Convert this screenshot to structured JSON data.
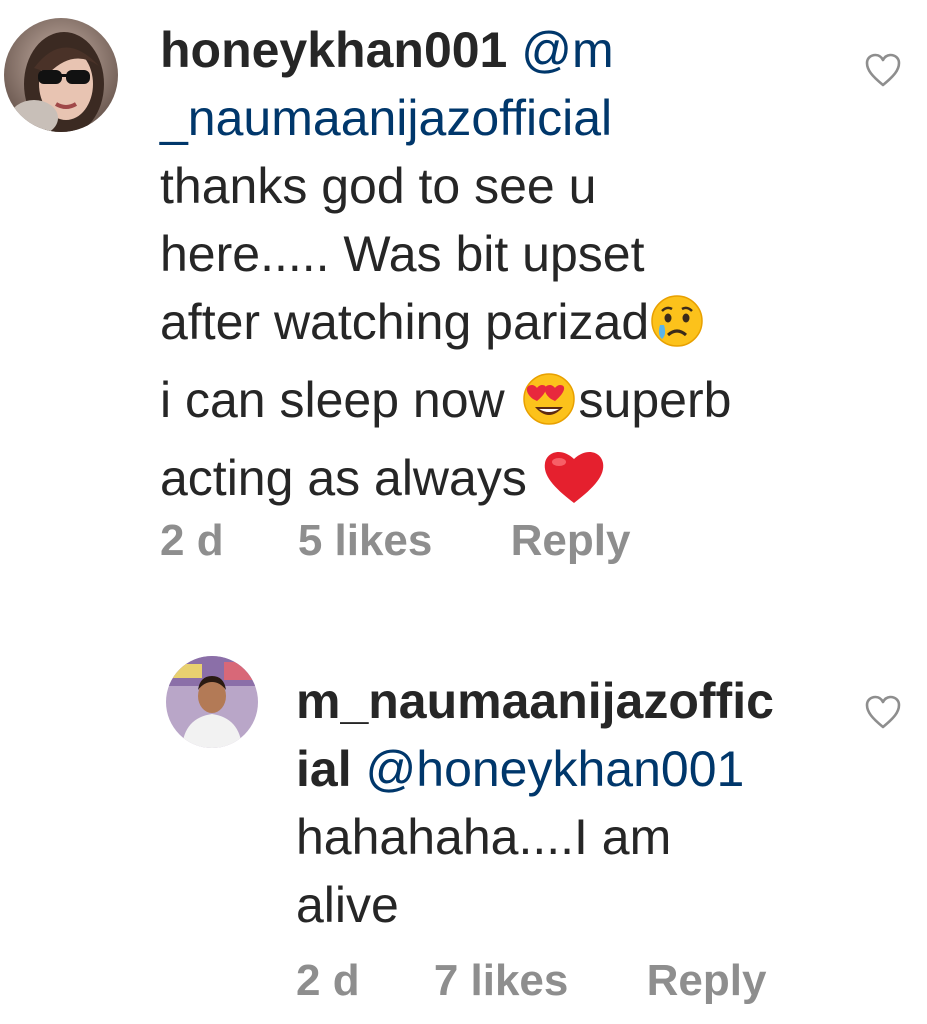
{
  "comments": [
    {
      "username": "honeykhan001",
      "mention_part1": "@m",
      "mention_part2": "_naumaanijazofficial",
      "text_line1": "thanks god  to see u",
      "text_line2": "here..... Was bit upset",
      "text_line3": "after watching parizad",
      "text_line4a": "i can sleep now ",
      "text_line4b": "superb",
      "text_line5": "acting as always ",
      "time": "2 d",
      "likes": "5 likes",
      "reply_label": "Reply",
      "emojis": [
        "crying-face-emoji",
        "heart-eyes-emoji",
        "red-heart-emoji"
      ]
    },
    {
      "username_part1": "m_naumaanijazoffic",
      "username_part2": "ial",
      "mention": "@honeykhan001",
      "text_line1": "hahahaha....I am",
      "text_line2": "alive",
      "time": "2 d",
      "likes": "7 likes",
      "reply_label": "Reply"
    }
  ],
  "colors": {
    "text": "#262626",
    "mention": "#00376b",
    "meta": "#8e8e8e",
    "heart_outline": "#8e8e8e"
  },
  "icons": [
    "like-heart-outline-icon"
  ]
}
